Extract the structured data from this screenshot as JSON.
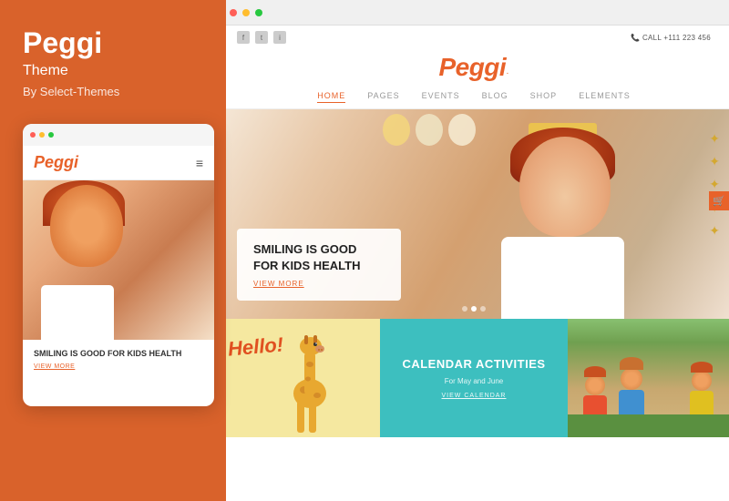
{
  "left": {
    "title": "Peggi",
    "theme_label": "Theme",
    "by_label": "By Select-Themes"
  },
  "mobile": {
    "logo": "Peggi",
    "headline": "SMILING IS GOOD FOR KIDS HEALTH",
    "view_more": "VIEW MORE"
  },
  "desktop": {
    "browser_dots": [
      "red",
      "yellow",
      "green"
    ],
    "social_icons": [
      "f",
      "t",
      "i"
    ],
    "call_label": "CALL",
    "call_number": "+111 223 456",
    "logo": "Peggi",
    "nav": [
      {
        "label": "HOME",
        "active": true
      },
      {
        "label": "PAGES",
        "active": false
      },
      {
        "label": "EVENTS",
        "active": false
      },
      {
        "label": "BLOG",
        "active": false
      },
      {
        "label": "SHOP",
        "active": false
      },
      {
        "label": "ELEMENTS",
        "active": false
      }
    ],
    "hero": {
      "headline": "SMILING IS GOOD FOR KIDS HEALTH",
      "view_more": "VIEW MORE"
    },
    "cards": [
      {
        "type": "hello",
        "hello_text": "Hello!"
      },
      {
        "type": "calendar",
        "title": "CALENDAR ACTIVITIES",
        "subtitle": "For May and June",
        "link": "VIEW CALENDAR"
      },
      {
        "type": "photo"
      }
    ]
  }
}
